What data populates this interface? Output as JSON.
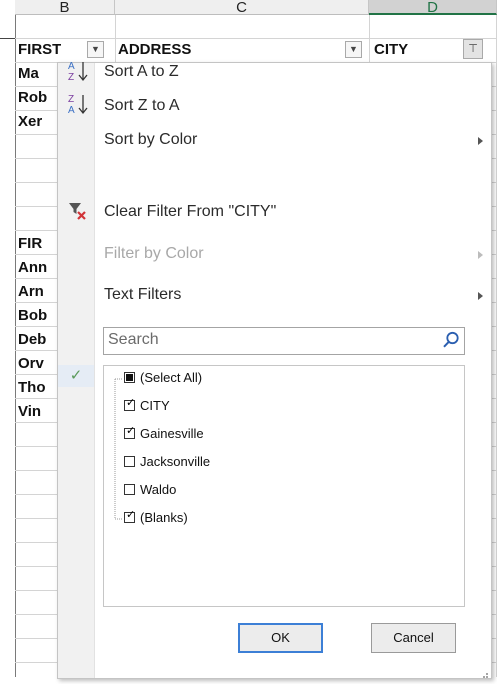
{
  "columns": {
    "b": "B",
    "c": "C",
    "d": "D"
  },
  "header_row": {
    "first": "FIRST",
    "address": "ADDRESS",
    "city": "CITY"
  },
  "cells": [
    "Ma",
    "Rob",
    "Xer",
    "FIR",
    "Ann",
    "Arn",
    "Bob",
    "Deb",
    "Orv",
    "Tho",
    "Vin"
  ],
  "menu": {
    "sort_az": "Sort A to Z",
    "sort_za": "Sort Z to A",
    "sort_color": "Sort by Color",
    "clear_filter": "Clear Filter From \"CITY\"",
    "filter_color": "Filter by Color",
    "text_filters": "Text Filters",
    "search_placeholder": "Search"
  },
  "filter_list": [
    {
      "label": "(Select All)",
      "state": "partial"
    },
    {
      "label": "CITY",
      "state": "checked"
    },
    {
      "label": "Gainesville",
      "state": "checked"
    },
    {
      "label": "Jacksonville",
      "state": "unchecked"
    },
    {
      "label": "Waldo",
      "state": "unchecked"
    },
    {
      "label": "(Blanks)",
      "state": "checked"
    }
  ],
  "buttons": {
    "ok": "OK",
    "cancel": "Cancel"
  },
  "colors": {
    "accent_green": "#217346",
    "ok_border": "#3c7fd6",
    "sort_blue": "#3a6fc4",
    "clear_red": "#d13438"
  }
}
